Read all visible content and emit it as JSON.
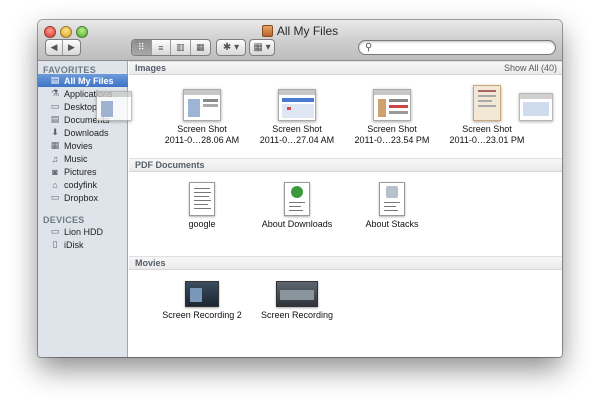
{
  "window": {
    "title": "All My Files"
  },
  "toolbar": {
    "back_icon": "◀",
    "forward_icon": "▶",
    "view_icons": [
      "⠿",
      "≡",
      "▥",
      "▦"
    ],
    "action_label": "✱ ▾",
    "arrange_label": "▦ ▾"
  },
  "search": {
    "value": "",
    "placeholder": ""
  },
  "sidebar": {
    "favorites_heading": "FAVORITES",
    "favorites": [
      {
        "label": "All My Files",
        "icon": "all-files-icon",
        "glyph": "▤",
        "selected": true
      },
      {
        "label": "Applications",
        "icon": "applications-icon",
        "glyph": "⚗"
      },
      {
        "label": "Desktop",
        "icon": "desktop-icon",
        "glyph": "▭"
      },
      {
        "label": "Documents",
        "icon": "documents-icon",
        "glyph": "▤"
      },
      {
        "label": "Downloads",
        "icon": "downloads-icon",
        "glyph": "⬇"
      },
      {
        "label": "Movies",
        "icon": "movies-icon",
        "glyph": "▦"
      },
      {
        "label": "Music",
        "icon": "music-icon",
        "glyph": "♫"
      },
      {
        "label": "Pictures",
        "icon": "pictures-icon",
        "glyph": "◙"
      },
      {
        "label": "codyfink",
        "icon": "home-icon",
        "glyph": "⌂"
      },
      {
        "label": "Dropbox",
        "icon": "dropbox-icon",
        "glyph": "▭"
      }
    ],
    "devices_heading": "DEVICES",
    "devices": [
      {
        "label": "Lion HDD",
        "icon": "hard-drive-icon",
        "glyph": "▭"
      },
      {
        "label": "iDisk",
        "icon": "idisk-icon",
        "glyph": "▯"
      }
    ]
  },
  "sections": {
    "images": {
      "title": "Images",
      "show_all": "Show All (40)",
      "items": [
        {
          "line1": "Screen Shot",
          "line2": "2011-0…28.06 AM"
        },
        {
          "line1": "Screen Shot",
          "line2": "2011-0…27.04 AM"
        },
        {
          "line1": "Screen Shot",
          "line2": "2011-0…23.54 PM"
        },
        {
          "line1": "Screen Shot",
          "line2": "2011-0…23.01 PM"
        }
      ]
    },
    "pdf": {
      "title": "PDF Documents",
      "items": [
        {
          "label": "google"
        },
        {
          "label": "About Downloads"
        },
        {
          "label": "About Stacks"
        }
      ]
    },
    "movies": {
      "title": "Movies",
      "items": [
        {
          "label": "Screen Recording 2"
        },
        {
          "label": "Screen Recording"
        }
      ]
    }
  },
  "colors": {
    "selection": "#3d73c7",
    "sidebar_bg": "#dee4ea",
    "section_title": "#56606b"
  }
}
